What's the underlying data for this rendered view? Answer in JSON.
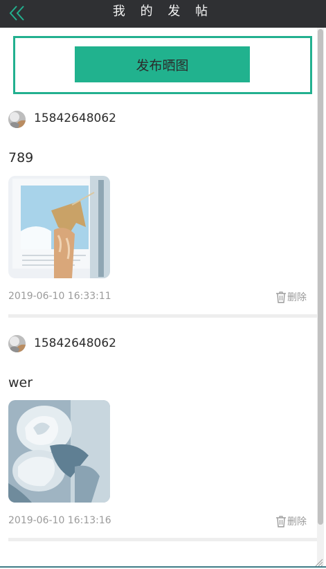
{
  "header": {
    "title": "我 的 发 帖",
    "back_icon": "double-chevron-left-icon",
    "back_icon_color": "#22b08f",
    "background": "#2f3033"
  },
  "publish": {
    "label": "发布晒图",
    "color": "#21b28e"
  },
  "posts": [
    {
      "username": "15842648062",
      "text": "789",
      "image": "cat-paw-book-photo",
      "timestamp": "2019-06-10 16:33:11",
      "delete_label": "删除",
      "delete_icon": "trash-icon"
    },
    {
      "username": "15842648062",
      "text": "wer",
      "image": "white-roses-photo",
      "timestamp": "2019-06-10 16:13:16",
      "delete_label": "删除",
      "delete_icon": "trash-icon"
    }
  ]
}
